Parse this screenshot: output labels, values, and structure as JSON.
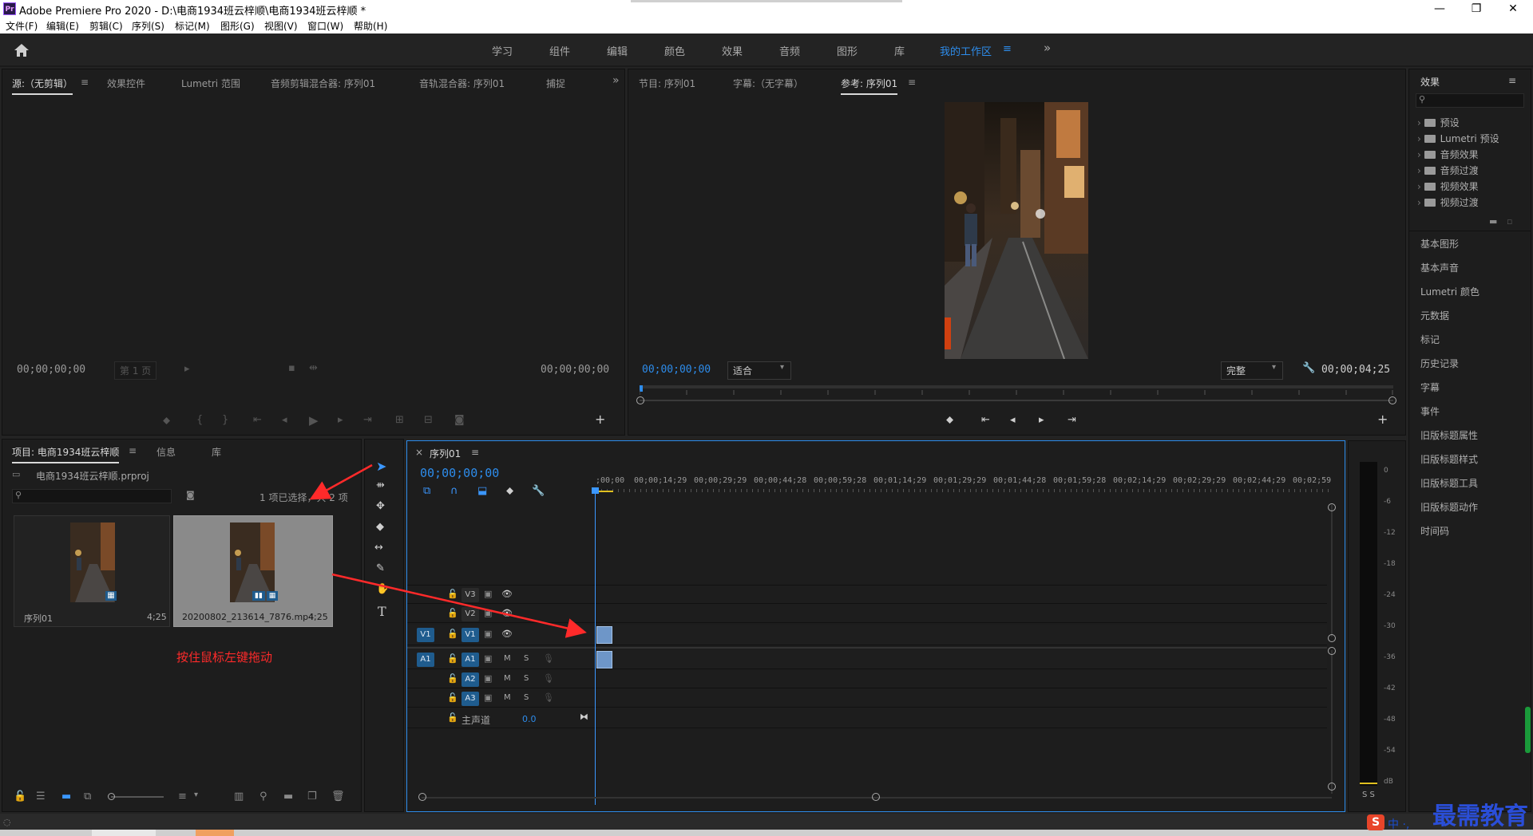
{
  "titlebar": {
    "app_icon": "Pr",
    "title": "Adobe Premiere Pro 2020 - D:\\电商1934班云梓顺\\电商1934班云梓顺 *",
    "minimize": "—",
    "restore": "❐",
    "close": "✕"
  },
  "menu": [
    "文件(F)",
    "编辑(E)",
    "剪辑(C)",
    "序列(S)",
    "标记(M)",
    "图形(G)",
    "视图(V)",
    "窗口(W)",
    "帮助(H)"
  ],
  "workspaces": {
    "items": [
      "学习",
      "组件",
      "编辑",
      "颜色",
      "效果",
      "音频",
      "图形",
      "库",
      "我的工作区"
    ],
    "active": "我的工作区",
    "menu_glyph": "≡",
    "more_glyph": "»"
  },
  "source_panel": {
    "tabs": [
      "源:（无剪辑）",
      "效果控件",
      "Lumetri 范围",
      "音频剪辑混合器: 序列01",
      "音轨混合器: 序列01",
      "捕捉"
    ],
    "tab_menu": "≡",
    "overflow": "»",
    "timecode_left": "00;00;00;00",
    "page_select": "第 1 页",
    "timecode_right": "00;00;00;00",
    "add": "+"
  },
  "program_panel": {
    "tabs": [
      "节目: 序列01",
      "字幕:（无字幕）",
      "参考: 序列01"
    ],
    "tab_menu": "≡",
    "timecode": "00;00;00;00",
    "fit_select": "适合",
    "quality_select": "完整",
    "duration": "00;00;04;25",
    "add": "+"
  },
  "project_panel": {
    "tabs": [
      "项目: 电商1934班云梓顺",
      "信息",
      "库"
    ],
    "tab_menu": "≡",
    "project_file": "电商1934班云梓顺.prproj",
    "search_placeholder": "",
    "selection_info": "1 项已选择，共 2 项",
    "items": [
      {
        "name": "序列01",
        "duration": "4;25"
      },
      {
        "name": "20200802_213614_7876.mp4",
        "duration": "4;25"
      }
    ],
    "annotation": "按住鼠标左键拖动"
  },
  "timeline": {
    "close": "×",
    "title": "序列01",
    "tab_menu": "≡",
    "timecode": "00;00;00;00",
    "ruler": [
      ";00;00",
      "00;00;14;29",
      "00;00;29;29",
      "00;00;44;28",
      "00;00;59;28",
      "00;01;14;29",
      "00;01;29;29",
      "00;01;44;28",
      "00;01;59;28",
      "00;02;14;29",
      "00;02;29;29",
      "00;02;44;29",
      "00;02;59"
    ],
    "video_tracks": [
      "V3",
      "V2",
      "V1"
    ],
    "audio_tracks": [
      "A1",
      "A2",
      "A3"
    ],
    "source_patch_video": "V1",
    "source_patch_audio": "A1",
    "master_label": "主声道",
    "master_value": "0.0",
    "mute": "M",
    "solo": "S"
  },
  "meter": {
    "ticks": [
      "0",
      "-6",
      "-12",
      "-18",
      "-24",
      "-30",
      "-36",
      "-42",
      "-48",
      "-54",
      "dB"
    ],
    "solo": "S S"
  },
  "effects_panel": {
    "title": "效果",
    "menu": "≡",
    "tree": [
      "预设",
      "Lumetri 预设",
      "音频效果",
      "音频过渡",
      "视频效果",
      "视频过渡"
    ],
    "sections": [
      "基本图形",
      "基本声音",
      "Lumetri 颜色",
      "元数据",
      "标记",
      "历史记录",
      "字幕",
      "事件",
      "旧版标题属性",
      "旧版标题样式",
      "旧版标题工具",
      "旧版标题动作",
      "时间码"
    ]
  },
  "ime": {
    "logo": "S",
    "text": "中 ·,",
    "watermark": "最需教育"
  },
  "colors": {
    "accent": "#2d8ceb",
    "clip": "#6e96c8",
    "annotation": "#ff2a2a",
    "track_button": "#1f5c8e"
  }
}
